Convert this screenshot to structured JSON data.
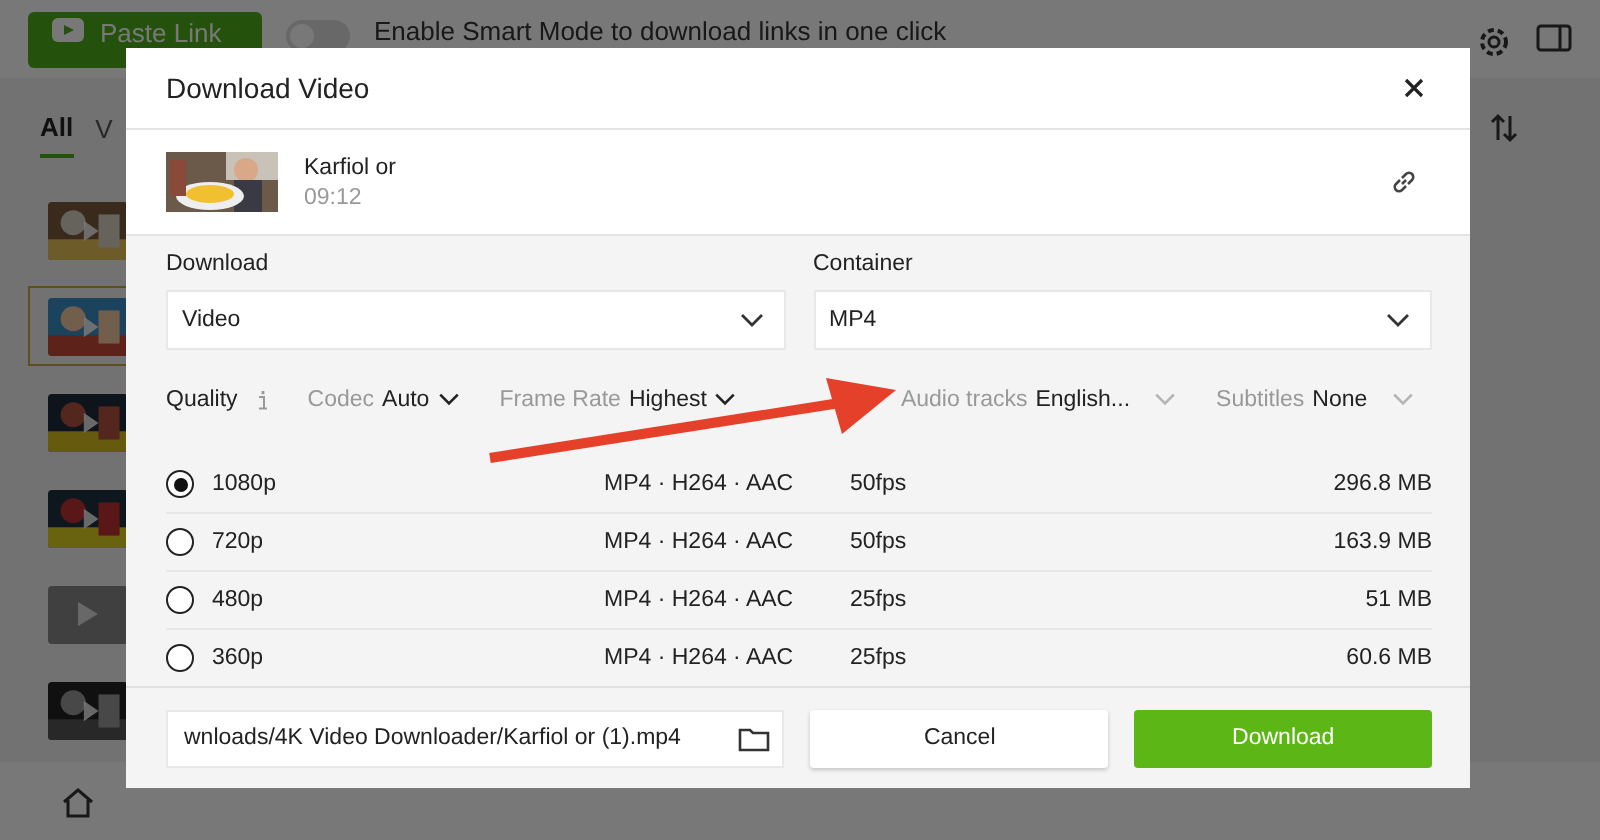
{
  "app": {
    "paste_button": "Paste Link",
    "smart_mode": {
      "on": false,
      "label": "Enable Smart Mode to download links in one click"
    },
    "tabs": [
      {
        "label": "All",
        "selected": true
      },
      {
        "label": "V",
        "selected": false
      }
    ],
    "items": [
      {
        "kind": "picture",
        "selected": false
      },
      {
        "kind": "picture",
        "selected": true
      },
      {
        "kind": "picture",
        "selected": false
      },
      {
        "kind": "picture",
        "selected": false
      },
      {
        "kind": "placeholder",
        "selected": false
      },
      {
        "kind": "picture",
        "selected": false
      }
    ]
  },
  "dialog": {
    "title": "Download Video",
    "video": {
      "title": "Karfiol or",
      "duration": "09:12"
    },
    "download": {
      "label": "Download",
      "value": "Video"
    },
    "container": {
      "label": "Container",
      "value": "MP4"
    },
    "options": [
      {
        "kind": "info",
        "label": "Quality"
      },
      {
        "kind": "select",
        "label": "Codec",
        "value": "Auto",
        "disabled": false
      },
      {
        "kind": "select",
        "label": "Frame Rate",
        "value": "Highest",
        "disabled": false
      },
      {
        "kind": "select",
        "label": "Audio tracks",
        "value": "English...",
        "disabled": true
      },
      {
        "kind": "select",
        "label": "Subtitles",
        "value": "None",
        "disabled": true
      }
    ],
    "formats": [
      {
        "resolution": "1080p",
        "selected": true,
        "spec": "MP4 · H264 · AAC",
        "fps": "50fps",
        "size": "296.8 MB"
      },
      {
        "resolution": "720p",
        "selected": false,
        "spec": "MP4 · H264 · AAC",
        "fps": "50fps",
        "size": "163.9 MB"
      },
      {
        "resolution": "480p",
        "selected": false,
        "spec": "MP4 · H264 · AAC",
        "fps": "25fps",
        "size": "51 MB"
      },
      {
        "resolution": "360p",
        "selected": false,
        "spec": "MP4 · H264 · AAC",
        "fps": "25fps",
        "size": "60.6 MB"
      }
    ],
    "path": "wnloads/4K Video Downloader/Karfiol or (1).mp4",
    "buttons": {
      "cancel": "Cancel",
      "download": "Download"
    }
  }
}
